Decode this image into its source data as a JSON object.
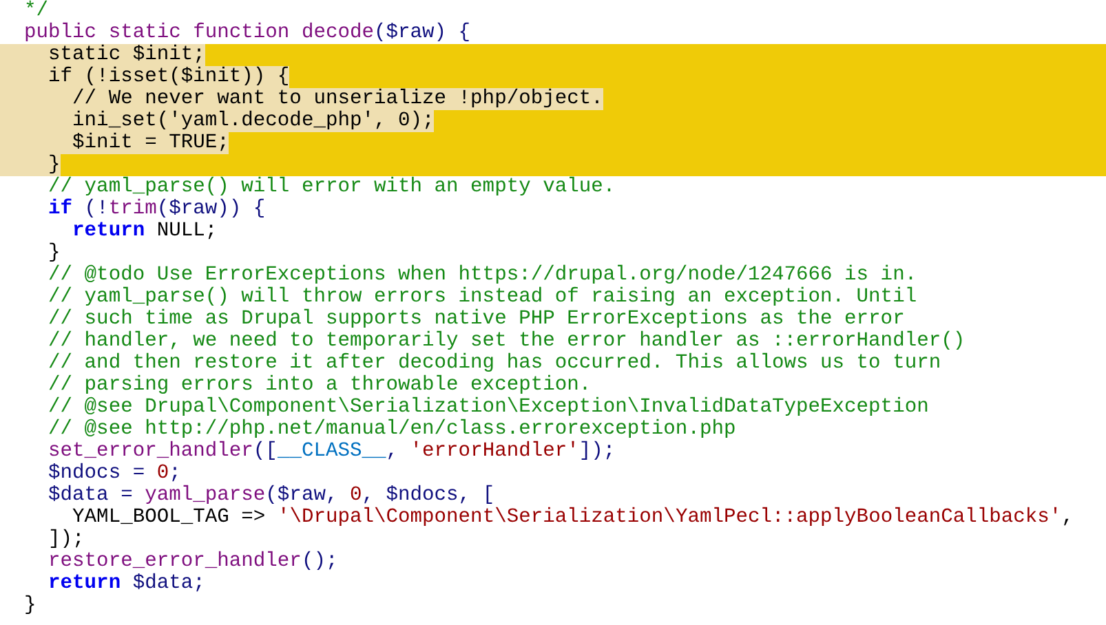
{
  "editor": {
    "lines": [
      {
        "highlighted": false,
        "tokens": [
          {
            "kind": "comment",
            "text": "  */"
          }
        ]
      },
      {
        "highlighted": false,
        "tokens": [
          {
            "kind": "declaration",
            "text": "  public static function decode"
          },
          {
            "kind": "punct",
            "text": "($raw) {"
          }
        ]
      },
      {
        "highlighted": true,
        "tokens": [
          {
            "kind": "plain",
            "text": "    static $init;"
          }
        ]
      },
      {
        "highlighted": true,
        "tokens": [
          {
            "kind": "plain",
            "text": "    if (!isset($init)) {"
          }
        ]
      },
      {
        "highlighted": true,
        "tokens": [
          {
            "kind": "plain",
            "text": "      // We never want to unserialize !php/object."
          }
        ]
      },
      {
        "highlighted": true,
        "tokens": [
          {
            "kind": "plain",
            "text": "      ini_set('yaml.decode_php', 0);"
          }
        ]
      },
      {
        "highlighted": true,
        "tokens": [
          {
            "kind": "plain",
            "text": "      $init = TRUE;"
          }
        ]
      },
      {
        "highlighted": true,
        "tokens": [
          {
            "kind": "plain",
            "text": "    }"
          }
        ]
      },
      {
        "highlighted": false,
        "tokens": [
          {
            "kind": "comment",
            "text": "    // yaml_parse() will error with an empty value."
          }
        ]
      },
      {
        "highlighted": false,
        "tokens": [
          {
            "kind": "keyword",
            "text": "    if"
          },
          {
            "kind": "punct",
            "text": " (!"
          },
          {
            "kind": "function",
            "text": "trim"
          },
          {
            "kind": "punct",
            "text": "($raw)) {"
          }
        ]
      },
      {
        "highlighted": false,
        "tokens": [
          {
            "kind": "keyword",
            "text": "      return"
          },
          {
            "kind": "plain",
            "text": " NULL;"
          }
        ]
      },
      {
        "highlighted": false,
        "tokens": [
          {
            "kind": "plain",
            "text": "    }"
          }
        ]
      },
      {
        "highlighted": false,
        "tokens": [
          {
            "kind": "comment",
            "text": "    // @todo Use ErrorExceptions when https://drupal.org/node/1247666 is in."
          }
        ]
      },
      {
        "highlighted": false,
        "tokens": [
          {
            "kind": "comment",
            "text": "    // yaml_parse() will throw errors instead of raising an exception. Until"
          }
        ]
      },
      {
        "highlighted": false,
        "tokens": [
          {
            "kind": "comment",
            "text": "    // such time as Drupal supports native PHP ErrorExceptions as the error"
          }
        ]
      },
      {
        "highlighted": false,
        "tokens": [
          {
            "kind": "comment",
            "text": "    // handler, we need to temporarily set the error handler as ::errorHandler()"
          }
        ]
      },
      {
        "highlighted": false,
        "tokens": [
          {
            "kind": "comment",
            "text": "    // and then restore it after decoding has occurred. This allows us to turn"
          }
        ]
      },
      {
        "highlighted": false,
        "tokens": [
          {
            "kind": "comment",
            "text": "    // parsing errors into a throwable exception."
          }
        ]
      },
      {
        "highlighted": false,
        "tokens": [
          {
            "kind": "comment",
            "text": "    // @see Drupal\\Component\\Serialization\\Exception\\InvalidDataTypeException"
          }
        ]
      },
      {
        "highlighted": false,
        "tokens": [
          {
            "kind": "comment",
            "text": "    // @see http://php.net/manual/en/class.errorexception.php"
          }
        ]
      },
      {
        "highlighted": false,
        "tokens": [
          {
            "kind": "function",
            "text": "    set_error_handler"
          },
          {
            "kind": "punct",
            "text": "(["
          },
          {
            "kind": "constant",
            "text": "__CLASS__"
          },
          {
            "kind": "punct",
            "text": ", "
          },
          {
            "kind": "string",
            "text": "'errorHandler'"
          },
          {
            "kind": "punct",
            "text": "]);"
          }
        ]
      },
      {
        "highlighted": false,
        "tokens": [
          {
            "kind": "punct",
            "text": "    $ndocs = "
          },
          {
            "kind": "number",
            "text": "0"
          },
          {
            "kind": "punct",
            "text": ";"
          }
        ]
      },
      {
        "highlighted": false,
        "tokens": [
          {
            "kind": "punct",
            "text": "    $data = "
          },
          {
            "kind": "function",
            "text": "yaml_parse"
          },
          {
            "kind": "punct",
            "text": "($raw, "
          },
          {
            "kind": "number",
            "text": "0"
          },
          {
            "kind": "punct",
            "text": ", $ndocs, ["
          }
        ]
      },
      {
        "highlighted": false,
        "tokens": [
          {
            "kind": "plain",
            "text": "      YAML_BOOL_TAG => "
          },
          {
            "kind": "string",
            "text": "'\\Drupal\\Component\\Serialization\\YamlPecl::applyBooleanCallbacks'"
          },
          {
            "kind": "plain",
            "text": ","
          }
        ]
      },
      {
        "highlighted": false,
        "tokens": [
          {
            "kind": "plain",
            "text": "    ]);"
          }
        ]
      },
      {
        "highlighted": false,
        "tokens": [
          {
            "kind": "function",
            "text": "    restore_error_handler"
          },
          {
            "kind": "punct",
            "text": "();"
          }
        ]
      },
      {
        "highlighted": false,
        "tokens": [
          {
            "kind": "keyword",
            "text": "    return"
          },
          {
            "kind": "punct",
            "text": " $data;"
          }
        ]
      },
      {
        "highlighted": false,
        "tokens": [
          {
            "kind": "plain",
            "text": "  }"
          }
        ]
      }
    ]
  }
}
